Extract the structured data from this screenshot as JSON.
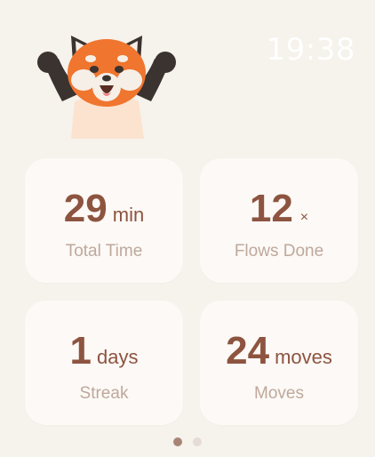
{
  "status_bar": {
    "time": "19:38"
  },
  "stats": [
    {
      "value": "29",
      "unit": "min",
      "label": "Total Time"
    },
    {
      "value": "12",
      "unit": "×",
      "label": "Flows Done"
    },
    {
      "value": "1",
      "unit": "days",
      "label": "Streak"
    },
    {
      "value": "24",
      "unit": "moves",
      "label": "Moves"
    }
  ],
  "pager": {
    "page_count": 2,
    "active_page": 1
  },
  "icons": {
    "mascot": "red-panda-cheering-icon"
  },
  "colors": {
    "background": "#f6f2ec",
    "card": "#fcf9f6",
    "value": "#8d5440",
    "label": "#bfa89c",
    "accent_orange": "#f0752f"
  }
}
